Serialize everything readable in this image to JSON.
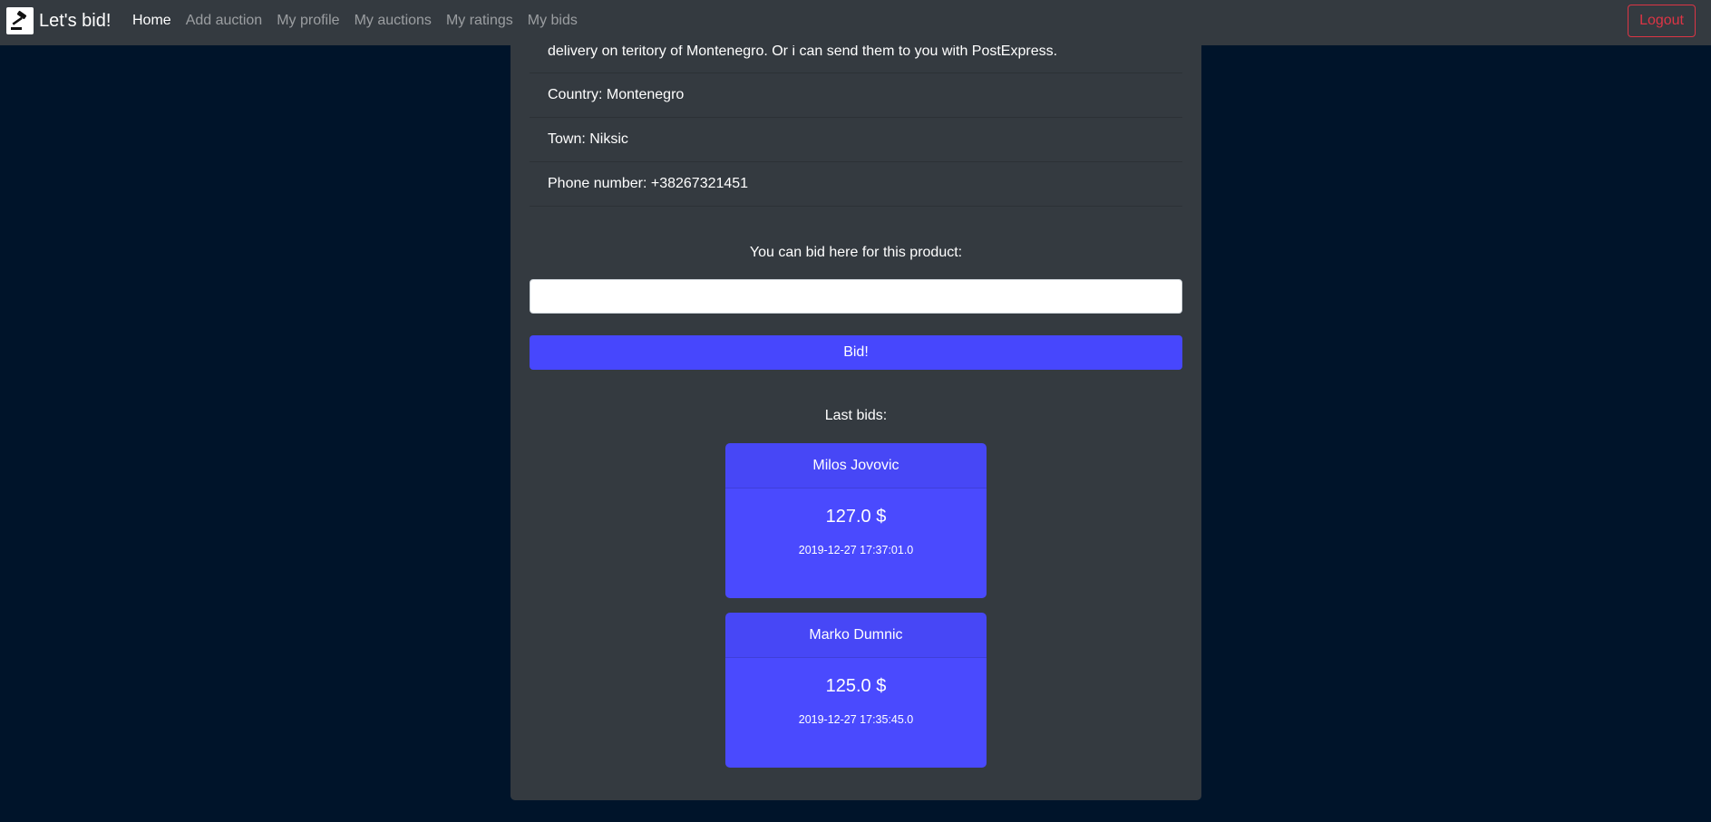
{
  "navbar": {
    "brand": "Let's bid!",
    "links": [
      {
        "label": "Home",
        "active": true
      },
      {
        "label": "Add auction",
        "active": false
      },
      {
        "label": "My profile",
        "active": false
      },
      {
        "label": "My auctions",
        "active": false
      },
      {
        "label": "My ratings",
        "active": false
      },
      {
        "label": "My bids",
        "active": false
      }
    ],
    "logout_label": "Logout"
  },
  "product_info": {
    "description_tail": "delivery on teritory of Montenegro. Or i can send them to you with PostExpress.",
    "country": "Country: Montenegro",
    "town": "Town: Niksic",
    "phone": "Phone number: +38267321451"
  },
  "bid_form": {
    "label": "You can bid here for this product:",
    "input_value": "",
    "button_label": "Bid!"
  },
  "last_bids": {
    "label": "Last bids:",
    "items": [
      {
        "bidder": "Milos Jovovic",
        "amount": "127.0 $",
        "date": "2019-12-27 17:37:01.0"
      },
      {
        "bidder": "Marko Dumnic",
        "amount": "125.0 $",
        "date": "2019-12-27 17:35:45.0"
      }
    ]
  },
  "colors": {
    "page_background": "#00142a",
    "navbar": "#343a40",
    "panel": "#343a40",
    "accent": "#4a4afe",
    "logout": "#dc3545"
  },
  "icons": {
    "brand_logo": "gavel-icon"
  }
}
